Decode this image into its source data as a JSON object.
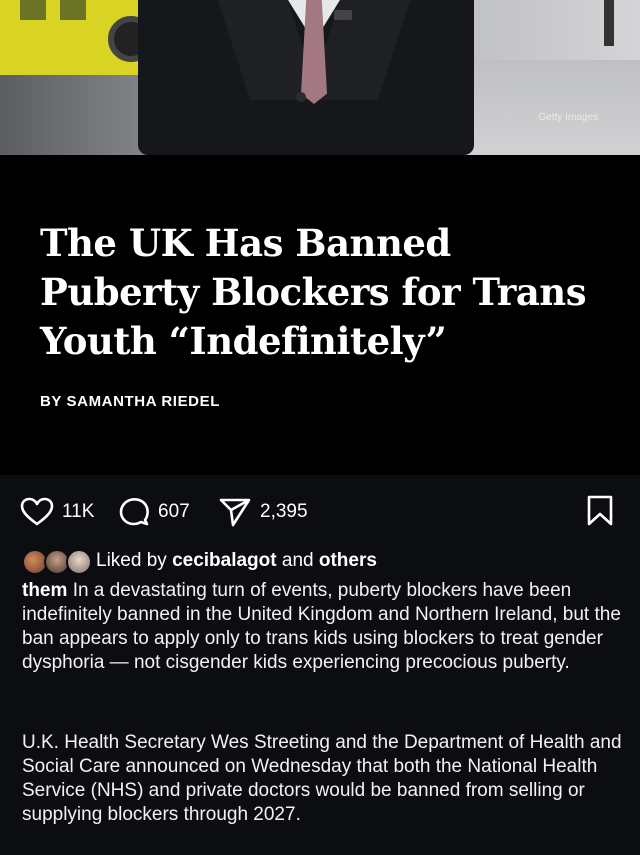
{
  "photo": {
    "credit": "Getty Images"
  },
  "article": {
    "headline": "The UK Has Banned Puberty Blockers for Trans Youth “Indefinitely”",
    "byline": "BY SAMANTHA RIEDEL"
  },
  "actions": {
    "likes": "11K",
    "comments": "607",
    "shares": "2,395",
    "icons": [
      "heart-icon",
      "comment-icon",
      "share-icon",
      "bookmark-icon"
    ]
  },
  "liked_by": {
    "prefix": "Liked by",
    "user": "cecibalagot",
    "and": "and",
    "others": "others"
  },
  "caption": {
    "username": "them",
    "text": "In a devastating turn of events, puberty blockers have been indefinitely banned in the United Kingdom and Northern Ireland, but the ban appears to apply only to trans kids using blockers to treat gender dysphoria — not cisgender kids experiencing precocious puberty.",
    "paragraph2": "U.K. Health Secretary Wes Streeting and the Department of Health and Social Care announced on Wednesday that both the National Health Service (NHS) and private doctors would be banned from selling or supplying blockers through 2027."
  }
}
